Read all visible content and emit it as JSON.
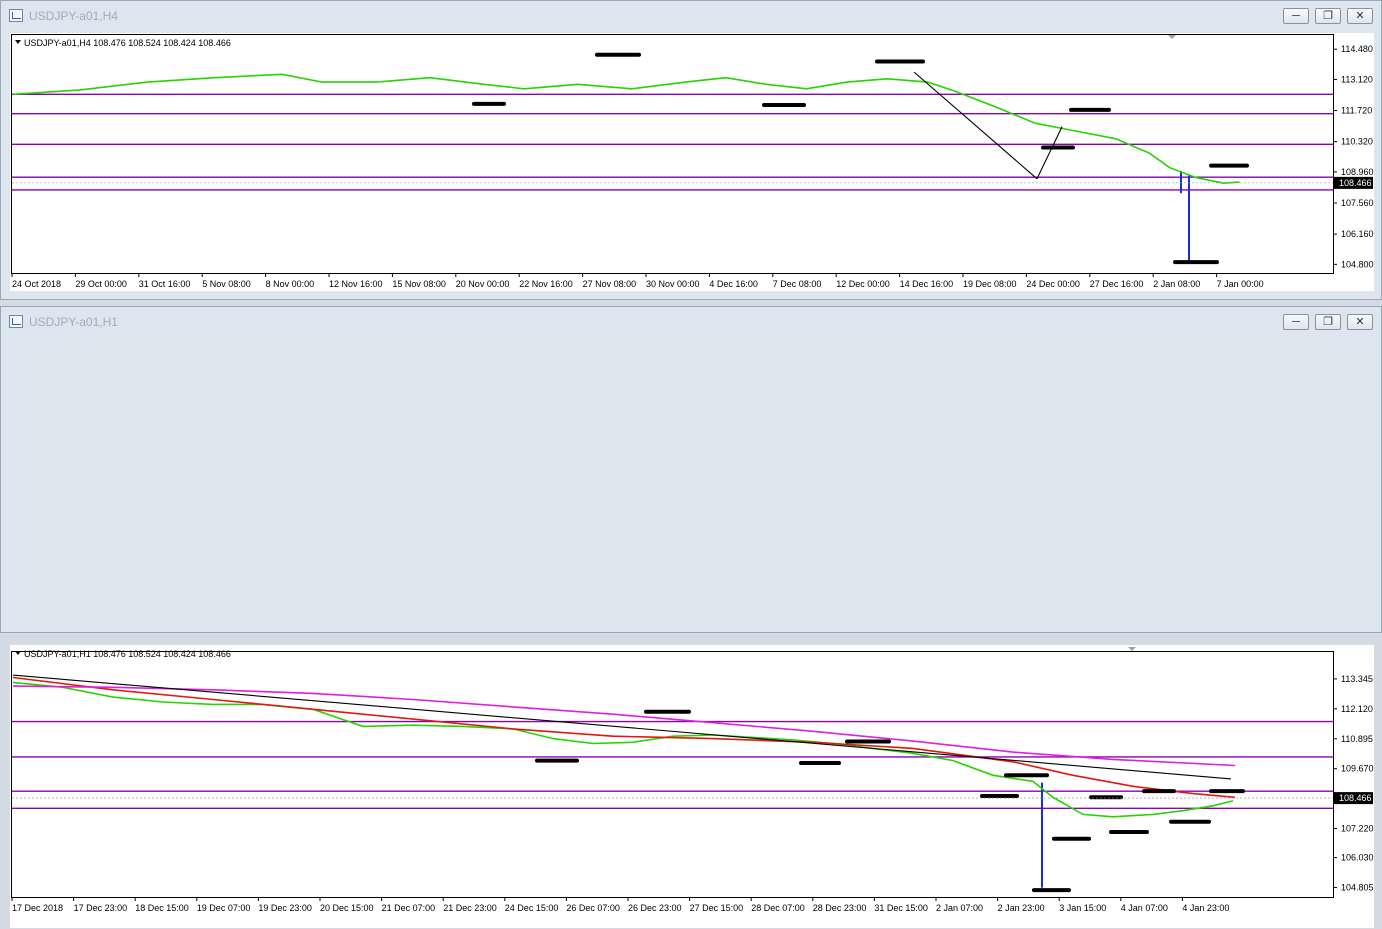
{
  "colors": {
    "bull": "#e0231f",
    "bear": "#1b2de0",
    "ma_fast": "#25d400",
    "ma_red": "#e0190f",
    "ma_magenta": "#e01ee0",
    "level": "#8a00b4",
    "trend": "#000000",
    "marker": "#000000"
  },
  "windows": [
    {
      "title": "USDJPY-a01,H4",
      "buttons": [
        "minimize",
        "restore",
        "close"
      ]
    },
    {
      "title": "USDJPY-a01,H1",
      "buttons": [
        "minimize",
        "restore",
        "close"
      ]
    }
  ],
  "chart_data": [
    {
      "type": "candlestick",
      "symbol": "USDJPY-a01",
      "timeframe": "H4",
      "header": "USDJPY-a01,H4  108.476 108.524 108.424 108.466",
      "last_price": "108.466",
      "ylim": [
        104.5,
        114.85
      ],
      "y_ticks": [
        "114.480",
        "113.120",
        "111.720",
        "110.320",
        "108.960",
        "107.560",
        "106.160",
        "104.800"
      ],
      "x_ticks": [
        "24 Oct 2018",
        "29 Oct 00:00",
        "31 Oct 16:00",
        "5 Nov 08:00",
        "8 Nov 00:00",
        "12 Nov 16:00",
        "15 Nov 08:00",
        "20 Nov 00:00",
        "22 Nov 16:00",
        "27 Nov 08:00",
        "30 Nov 00:00",
        "4 Dec 16:00",
        "7 Dec 08:00",
        "12 Dec 00:00",
        "14 Dec 16:00",
        "19 Dec 08:00",
        "24 Dec 00:00",
        "27 Dec 16:00",
        "2 Jan 08:00",
        "7 Jan 00:00"
      ],
      "price_path": [
        [
          0,
          112.55
        ],
        [
          12,
          112.1
        ],
        [
          40,
          112.4
        ],
        [
          70,
          113.0
        ],
        [
          110,
          113.3
        ],
        [
          150,
          113.4
        ],
        [
          170,
          113.8
        ],
        [
          185,
          113.5
        ],
        [
          205,
          113.7
        ],
        [
          215,
          113.3
        ],
        [
          235,
          112.7
        ],
        [
          245,
          112.5
        ],
        [
          262,
          113.1
        ],
        [
          285,
          113.3
        ],
        [
          300,
          113.4
        ],
        [
          310,
          113.6
        ],
        [
          322,
          113.2
        ],
        [
          340,
          113.4
        ],
        [
          352,
          112.7
        ],
        [
          364,
          112.5
        ],
        [
          385,
          112.3
        ],
        [
          400,
          113.3
        ],
        [
          415,
          113.0
        ],
        [
          440,
          112.7
        ],
        [
          452,
          112.4
        ],
        [
          465,
          112.5
        ],
        [
          478,
          112.8
        ],
        [
          495,
          113.0
        ],
        [
          510,
          113.0
        ],
        [
          525,
          113.5
        ],
        [
          545,
          113.25
        ],
        [
          560,
          112.7
        ],
        [
          575,
          112.3
        ],
        [
          590,
          112.35
        ],
        [
          605,
          113.1
        ],
        [
          625,
          113.2
        ],
        [
          640,
          113.5
        ],
        [
          660,
          113.4
        ],
        [
          670,
          113.0
        ],
        [
          680,
          112.6
        ],
        [
          685,
          112.55
        ],
        [
          700,
          111.65
        ],
        [
          730,
          111.4
        ],
        [
          745,
          110.95
        ],
        [
          758,
          110.6
        ],
        [
          775,
          111.0
        ],
        [
          790,
          110.7
        ],
        [
          810,
          110.3
        ],
        [
          830,
          109.9
        ],
        [
          845,
          109.35
        ],
        [
          857,
          108.75
        ],
        [
          866,
          107.7
        ],
        [
          880,
          107.9
        ],
        [
          900,
          108.5
        ],
        [
          912,
          108.55
        ]
      ],
      "series": [
        {
          "name": "",
          "values": [
            [
              0,
              112.45
            ],
            [
              50,
              112.65
            ],
            [
              100,
              113.0
            ],
            [
              150,
              113.2
            ],
            [
              200,
              113.35
            ],
            [
              230,
              113.0
            ],
            [
              270,
              113.0
            ],
            [
              310,
              113.2
            ],
            [
              350,
              112.9
            ],
            [
              380,
              112.7
            ],
            [
              420,
              112.9
            ],
            [
              460,
              112.7
            ],
            [
              500,
              113.0
            ],
            [
              530,
              113.2
            ],
            [
              560,
              112.9
            ],
            [
              590,
              112.7
            ],
            [
              620,
              113.0
            ],
            [
              650,
              113.15
            ],
            [
              680,
              113.0
            ],
            [
              700,
              112.6
            ],
            [
              730,
              111.9
            ],
            [
              760,
              111.15
            ],
            [
              790,
              110.8
            ],
            [
              820,
              110.45
            ],
            [
              845,
              109.8
            ],
            [
              860,
              109.15
            ],
            [
              880,
              108.7
            ],
            [
              900,
              108.45
            ],
            [
              912,
              108.5
            ]
          ]
        }
      ],
      "levels": [
        112.45,
        111.58,
        110.2,
        108.72,
        108.15
      ],
      "trendlines": [
        [
          [
            670,
            113.45
          ],
          [
            1028,
            108.65
          ]
        ],
        [
          [
            780,
            111.0
          ],
          [
            1028,
            108.65
          ]
        ]
      ],
      "markers": [
        [
          112.02,
          465,
          495
        ],
        [
          114.23,
          588,
          630
        ],
        [
          113.93,
          868,
          914
        ],
        [
          111.97,
          755,
          795
        ],
        [
          111.75,
          1062,
          1100
        ],
        [
          110.06,
          1034,
          1064
        ],
        [
          109.24,
          1202,
          1238
        ],
        [
          104.9,
          1166,
          1208
        ]
      ]
    },
    {
      "type": "candlestick",
      "symbol": "USDJPY-a01",
      "timeframe": "H1",
      "header": "USDJPY-a01,H1  108.476 108.524 108.424 108.466",
      "last_price": "108.466",
      "ylim": [
        104.5,
        114.2
      ],
      "y_ticks": [
        "113.345",
        "112.120",
        "110.895",
        "109.670",
        "108.466",
        "107.220",
        "106.030",
        "104.805"
      ],
      "x_ticks": [
        "17 Dec 2018",
        "17 Dec 23:00",
        "18 Dec 15:00",
        "19 Dec 07:00",
        "19 Dec 23:00",
        "20 Dec 15:00",
        "21 Dec 07:00",
        "21 Dec 23:00",
        "24 Dec 15:00",
        "26 Dec 07:00",
        "26 Dec 23:00",
        "27 Dec 15:00",
        "28 Dec 07:00",
        "28 Dec 23:00",
        "31 Dec 15:00",
        "2 Jan 07:00",
        "2 Jan 23:00",
        "3 Jan 15:00",
        "4 Jan 07:00",
        "4 Jan 23:00"
      ],
      "price_path": [
        [
          0,
          113.4
        ],
        [
          40,
          113.1
        ],
        [
          100,
          112.6
        ],
        [
          160,
          112.5
        ],
        [
          200,
          112.4
        ],
        [
          240,
          112.3
        ],
        [
          260,
          112.5
        ],
        [
          290,
          112.1
        ],
        [
          320,
          111.7
        ],
        [
          345,
          111.3
        ],
        [
          365,
          111.4
        ],
        [
          400,
          111.6
        ],
        [
          430,
          111.35
        ],
        [
          470,
          111.4
        ],
        [
          500,
          111.05
        ],
        [
          520,
          110.8
        ],
        [
          545,
          110.65
        ],
        [
          570,
          110.75
        ],
        [
          600,
          110.85
        ],
        [
          620,
          110.7
        ],
        [
          635,
          111.4
        ],
        [
          660,
          111.5
        ],
        [
          690,
          111.2
        ],
        [
          720,
          111.0
        ],
        [
          740,
          111.1
        ],
        [
          760,
          110.95
        ],
        [
          790,
          110.8
        ],
        [
          810,
          110.6
        ],
        [
          830,
          110.9
        ],
        [
          850,
          110.8
        ],
        [
          870,
          110.5
        ],
        [
          890,
          110.2
        ],
        [
          910,
          110.05
        ],
        [
          935,
          109.9
        ],
        [
          960,
          109.6
        ],
        [
          980,
          109.25
        ],
        [
          995,
          109.5
        ],
        [
          1010,
          109.7
        ],
        [
          1022,
          109.1
        ],
        [
          1030,
          108.5
        ],
        [
          1035,
          107.6
        ],
        [
          1048,
          106.9
        ],
        [
          1063,
          107.1
        ],
        [
          1080,
          107.55
        ],
        [
          1100,
          107.75
        ],
        [
          1120,
          107.45
        ],
        [
          1140,
          107.6
        ],
        [
          1155,
          108.3
        ],
        [
          1175,
          108.0
        ],
        [
          1200,
          108.3
        ],
        [
          1215,
          108.4
        ]
      ],
      "series": [
        {
          "name": "",
          "values": [
            [
              0,
              113.2
            ],
            [
              50,
              113.0
            ],
            [
              100,
              112.6
            ],
            [
              150,
              112.4
            ],
            [
              200,
              112.3
            ],
            [
              250,
              112.3
            ],
            [
              300,
              112.1
            ],
            [
              350,
              111.4
            ],
            [
              400,
              111.45
            ],
            [
              450,
              111.4
            ],
            [
              500,
              111.3
            ],
            [
              540,
              110.9
            ],
            [
              580,
              110.7
            ],
            [
              620,
              110.75
            ],
            [
              660,
              111.0
            ],
            [
              700,
              111.05
            ],
            [
              740,
              110.95
            ],
            [
              780,
              110.85
            ],
            [
              820,
              110.7
            ],
            [
              860,
              110.5
            ],
            [
              900,
              110.3
            ],
            [
              940,
              110.0
            ],
            [
              980,
              109.4
            ],
            [
              1020,
              109.15
            ],
            [
              1040,
              108.5
            ],
            [
              1070,
              107.8
            ],
            [
              1100,
              107.7
            ],
            [
              1140,
              107.8
            ],
            [
              1170,
              107.95
            ],
            [
              1200,
              108.15
            ],
            [
              1220,
              108.35
            ]
          ]
        },
        {
          "name": "",
          "values": [
            [
              0,
              113.4
            ],
            [
              100,
              112.9
            ],
            [
              200,
              112.5
            ],
            [
              300,
              112.1
            ],
            [
              400,
              111.7
            ],
            [
              500,
              111.3
            ],
            [
              600,
              111.0
            ],
            [
              700,
              110.9
            ],
            [
              800,
              110.75
            ],
            [
              900,
              110.5
            ],
            [
              1000,
              109.95
            ],
            [
              1060,
              109.4
            ],
            [
              1120,
              108.95
            ],
            [
              1180,
              108.65
            ],
            [
              1222,
              108.5
            ]
          ]
        },
        {
          "name": "",
          "values": [
            [
              0,
              113.05
            ],
            [
              100,
              113.0
            ],
            [
              200,
              112.9
            ],
            [
              300,
              112.75
            ],
            [
              400,
              112.5
            ],
            [
              500,
              112.2
            ],
            [
              600,
              111.9
            ],
            [
              700,
              111.55
            ],
            [
              800,
              111.2
            ],
            [
              900,
              110.8
            ],
            [
              1000,
              110.35
            ],
            [
              1100,
              110.05
            ],
            [
              1222,
              109.8
            ]
          ]
        }
      ],
      "levels": [
        111.6,
        110.15,
        108.75,
        108.05
      ],
      "trendlines": [
        [
          [
            0,
            113.5
          ],
          [
            1222,
            109.25
          ]
        ]
      ],
      "markers": [
        [
          112.0,
          637,
          680
        ],
        [
          110.78,
          838,
          880
        ],
        [
          109.4,
          997,
          1038
        ],
        [
          110.0,
          528,
          568
        ],
        [
          109.9,
          792,
          830
        ],
        [
          108.55,
          973,
          1008
        ],
        [
          108.5,
          1082,
          1112
        ],
        [
          108.75,
          1135,
          1165
        ],
        [
          108.75,
          1202,
          1234
        ],
        [
          106.8,
          1045,
          1080
        ],
        [
          107.08,
          1102,
          1138
        ],
        [
          107.5,
          1162,
          1200
        ],
        [
          104.7,
          1025,
          1060
        ]
      ]
    }
  ]
}
